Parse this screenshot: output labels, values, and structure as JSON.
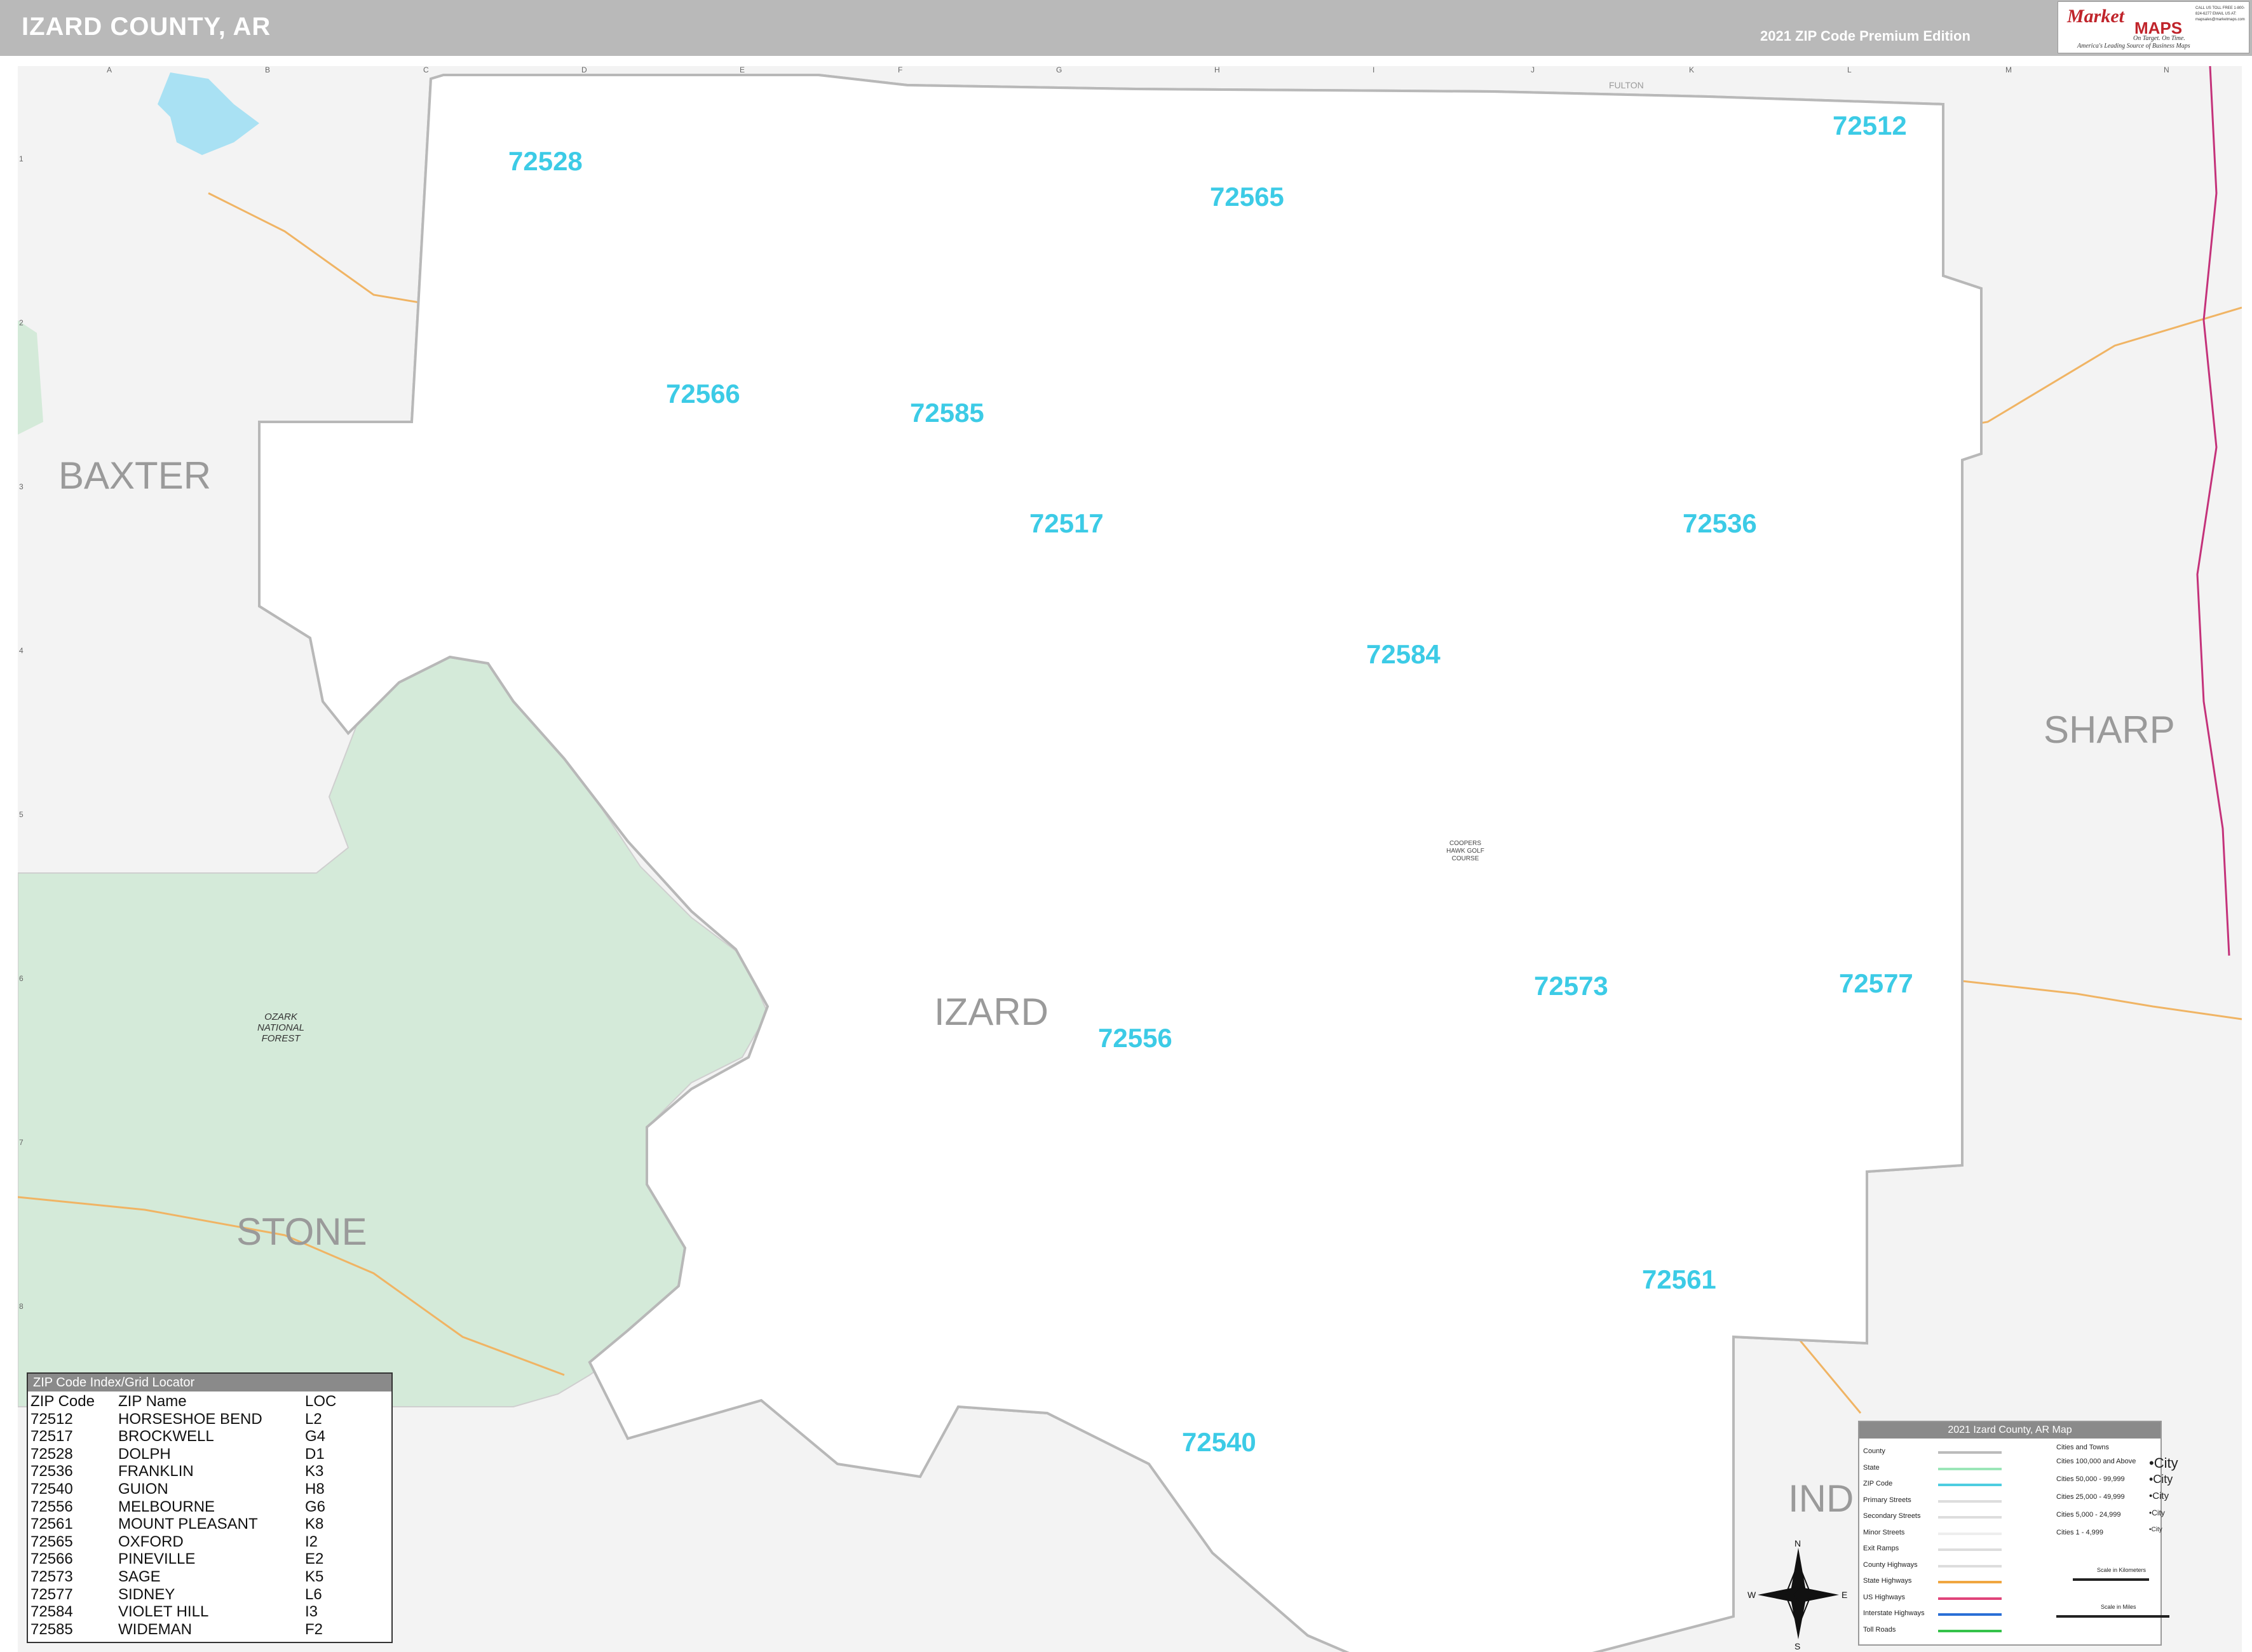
{
  "header": {
    "title": "IZARD COUNTY, AR",
    "edition": "2021 ZIP Code Premium Edition"
  },
  "logo": {
    "brand_a": "Market",
    "brand_b": "MAPS",
    "tagline": "On Target. On Time.",
    "tagline2": "America's Leading Source of Business Maps",
    "contact": "CALL US TOLL FREE 1-800-824-6277 EMAIL US AT: mapsales@marketmaps.com"
  },
  "grid": {
    "columns": [
      "A",
      "B",
      "C",
      "D",
      "E",
      "F",
      "G",
      "H",
      "I",
      "J",
      "K",
      "L",
      "M",
      "N"
    ],
    "rows": [
      "1",
      "2",
      "3",
      "4",
      "5",
      "6",
      "7",
      "8"
    ]
  },
  "counties": [
    {
      "name": "BAXTER"
    },
    {
      "name": "SHARP"
    },
    {
      "name": "STONE"
    },
    {
      "name": "IZARD"
    },
    {
      "name": "IND"
    },
    {
      "name": "FULTON"
    }
  ],
  "zip_labels": [
    "72528",
    "72565",
    "72512",
    "72566",
    "72585",
    "72517",
    "72536",
    "72584",
    "72573",
    "72577",
    "72556",
    "72561",
    "72540"
  ],
  "place_labels": {
    "forest": "OZARK NATIONAL FOREST",
    "golf": "COOPERS HAWK GOLF COURSE"
  },
  "zip_index": {
    "title": "ZIP Code Index/Grid Locator",
    "headers": [
      "ZIP Code",
      "ZIP Name",
      "LOC"
    ],
    "rows": [
      [
        "72512",
        "HORSESHOE BEND",
        "L2"
      ],
      [
        "72517",
        "BROCKWELL",
        "G4"
      ],
      [
        "72528",
        "DOLPH",
        "D1"
      ],
      [
        "72536",
        "FRANKLIN",
        "K3"
      ],
      [
        "72540",
        "GUION",
        "H8"
      ],
      [
        "72556",
        "MELBOURNE",
        "G6"
      ],
      [
        "72561",
        "MOUNT PLEASANT",
        "K8"
      ],
      [
        "72565",
        "OXFORD",
        "I2"
      ],
      [
        "72566",
        "PINEVILLE",
        "E2"
      ],
      [
        "72573",
        "SAGE",
        "K5"
      ],
      [
        "72577",
        "SIDNEY",
        "L6"
      ],
      [
        "72584",
        "VIOLET HILL",
        "I3"
      ],
      [
        "72585",
        "WIDEMAN",
        "F2"
      ]
    ]
  },
  "legend": {
    "title": "2021 Izard County, AR Map",
    "items": [
      {
        "label": "County",
        "color": "#bbbbbb"
      },
      {
        "label": "State",
        "color": "#9be6b8"
      },
      {
        "label": "ZIP Code",
        "color": "#4dcde0"
      },
      {
        "label": "Primary Streets",
        "color": "#dddddd"
      },
      {
        "label": "Secondary Streets",
        "color": "#dddddd"
      },
      {
        "label": "Minor Streets",
        "color": "#eeeeee"
      },
      {
        "label": "Exit Ramps",
        "color": "#dddddd"
      },
      {
        "label": "County Highways",
        "color": "#dddddd"
      },
      {
        "label": "State Highways",
        "color": "#f0a640"
      },
      {
        "label": "US Highways",
        "color": "#e0447a"
      },
      {
        "label": "Interstate Highways",
        "color": "#2a6fd6"
      },
      {
        "label": "Toll Roads",
        "color": "#35c24a"
      }
    ],
    "cities_header": "Cities and Towns",
    "pop": [
      {
        "label": "Cities 100,000 and Above",
        "sym": "•City"
      },
      {
        "label": "Cities 50,000 - 99,999",
        "sym": "•City"
      },
      {
        "label": "Cities 25,000 - 49,999",
        "sym": "•City"
      },
      {
        "label": "Cities 5,000 - 24,999",
        "sym": "•City"
      },
      {
        "label": "Cities 1 - 4,999",
        "sym": "•City"
      }
    ],
    "scale_km": "Scale in Kilometers",
    "scale_mi": "Scale in Miles"
  },
  "colors": {
    "zip_label": "#3ccbe6",
    "zip_boundary": "#5ccfe0",
    "county_label": "#9a9a9a",
    "forest": "#cfe7d8",
    "water": "#a7e0f2",
    "state_hwy": "#f0b464",
    "us_hwy": "#c4327a"
  }
}
